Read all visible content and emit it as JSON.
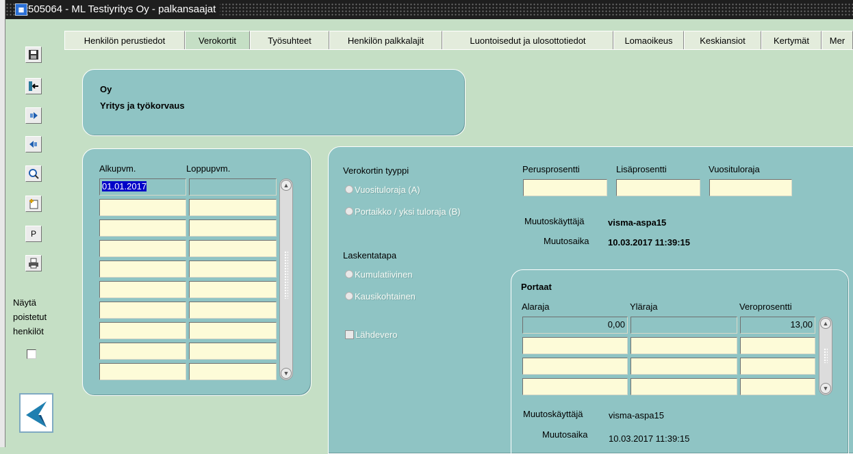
{
  "window": {
    "title": "505064 - ML Testiyritys Oy - palkansaajat"
  },
  "toolbar": {
    "buttons": [
      {
        "name": "save",
        "label": ""
      },
      {
        "name": "exit",
        "label": ""
      },
      {
        "name": "next",
        "label": ""
      },
      {
        "name": "previous",
        "label": ""
      },
      {
        "name": "search",
        "label": ""
      },
      {
        "name": "new",
        "label": ""
      },
      {
        "name": "p",
        "label": "P"
      },
      {
        "name": "print",
        "label": ""
      }
    ],
    "show_deleted_label_1": "Näytä",
    "show_deleted_label_2": "poistetut",
    "show_deleted_label_3": "henkilöt"
  },
  "tabs": [
    {
      "label": "Henkilön perustiedot",
      "active": false
    },
    {
      "label": "Verokortit",
      "active": true
    },
    {
      "label": "Työsuhteet",
      "active": false
    },
    {
      "label": "Henkilön palkkalajit",
      "active": false
    },
    {
      "label": "Luontoisedut ja ulosottotiedot",
      "active": false
    },
    {
      "label": "Lomaoikeus",
      "active": false
    },
    {
      "label": "Keskiansiot",
      "active": false
    },
    {
      "label": "Kertymät",
      "active": false
    },
    {
      "label": "Mer",
      "active": false
    }
  ],
  "company": {
    "line1": "Oy",
    "line2": "Yritys ja työkorvaus"
  },
  "dates": {
    "col_start": "Alkupvm.",
    "col_end": "Loppupvm.",
    "rows": [
      {
        "start": "01.01.2017",
        "end": ""
      },
      {
        "start": "",
        "end": ""
      },
      {
        "start": "",
        "end": ""
      },
      {
        "start": "",
        "end": ""
      },
      {
        "start": "",
        "end": ""
      },
      {
        "start": "",
        "end": ""
      },
      {
        "start": "",
        "end": ""
      },
      {
        "start": "",
        "end": ""
      },
      {
        "start": "",
        "end": ""
      },
      {
        "start": "",
        "end": ""
      }
    ]
  },
  "taxcard": {
    "type_label": "Verokortin tyyppi",
    "type_opt_a": "Vuosituloraja (A)",
    "type_opt_b": "Portaikko / yksi tuloraja (B)",
    "method_label": "Laskentatapa",
    "method_opt_1": "Kumulatiivinen",
    "method_opt_2": "Kausikohtainen",
    "withholding_label": "Lähdevero",
    "base_pct_label": "Perusprosentti",
    "extra_pct_label": "Lisäprosentti",
    "annual_limit_label": "Vuosituloraja",
    "base_pct": "",
    "extra_pct": "",
    "annual_limit": "",
    "modified_by_label": "Muutoskäyttäjä",
    "modified_by": "visma-aspa15",
    "modified_at_label": "Muutosaika",
    "modified_at": "10.03.2017 11:39:15"
  },
  "steps": {
    "title": "Portaat",
    "col_lower": "Alaraja",
    "col_upper": "Yläraja",
    "col_pct": "Veroprosentti",
    "rows": [
      {
        "lower": "0,00",
        "upper": "",
        "pct": "13,00"
      },
      {
        "lower": "",
        "upper": "",
        "pct": ""
      },
      {
        "lower": "",
        "upper": "",
        "pct": ""
      },
      {
        "lower": "",
        "upper": "",
        "pct": ""
      }
    ],
    "modified_by_label": "Muutoskäyttäjä",
    "modified_by": "visma-aspa15",
    "modified_at_label": "Muutosaika",
    "modified_at": "10.03.2017 11:39:15"
  },
  "colors": {
    "background": "#c5dfc5",
    "panel": "#8fc4c4",
    "field": "#fdfbd8",
    "selection": "#0000c8"
  }
}
